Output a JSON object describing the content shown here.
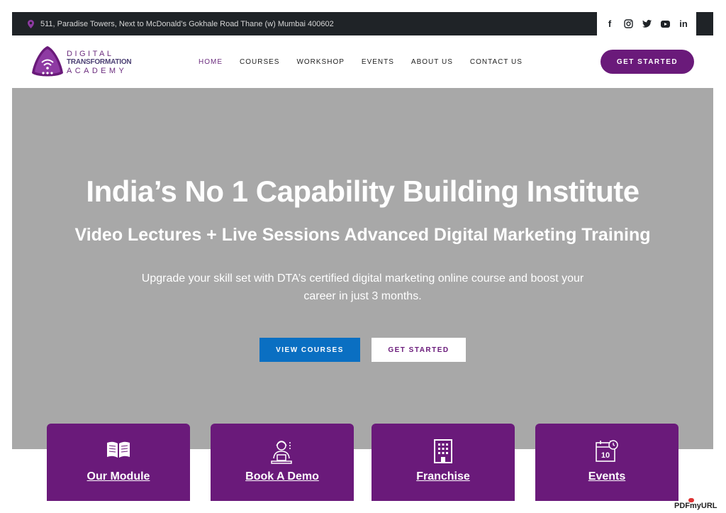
{
  "topbar": {
    "address": "511, Paradise Towers, Next to McDonald’s Gokhale Road Thane (w) Mumbai 400602",
    "social": [
      "facebook-icon",
      "instagram-icon",
      "twitter-icon",
      "youtube-icon",
      "linkedin-icon"
    ]
  },
  "logo": {
    "line1": "DIGITAL",
    "line2": "TRANSFORMATION",
    "line3": "ACADEMY"
  },
  "nav": {
    "items": [
      {
        "label": "HOME"
      },
      {
        "label": "COURSES"
      },
      {
        "label": "WORKSHOP"
      },
      {
        "label": "EVENTS"
      },
      {
        "label": "ABOUT US"
      },
      {
        "label": "CONTACT US"
      }
    ],
    "active": "HOME",
    "cta": "GET STARTED"
  },
  "hero": {
    "title": "India’s No 1 Capability Building Institute",
    "subtitle": "Video Lectures + Live Sessions Advanced Digital Marketing Training",
    "description": "Upgrade your skill set with DTA’s certified digital marketing online course and boost your career in just 3 months.",
    "primary_button": "VIEW COURSES",
    "secondary_button": "GET STARTED"
  },
  "cards": [
    {
      "label": "Our Module",
      "icon": "book-icon"
    },
    {
      "label": "Book A Demo",
      "icon": "presenter-icon"
    },
    {
      "label": "Franchise",
      "icon": "building-icon"
    },
    {
      "label": "Events",
      "icon": "calendar-icon",
      "icon_text": "10"
    }
  ],
  "watermark": "PDFmyURL",
  "colors": {
    "brand_purple": "#6a1a7a",
    "blue": "#0a6fc2",
    "topbar": "#1f2327",
    "hero_bg": "#a8a8a8"
  }
}
